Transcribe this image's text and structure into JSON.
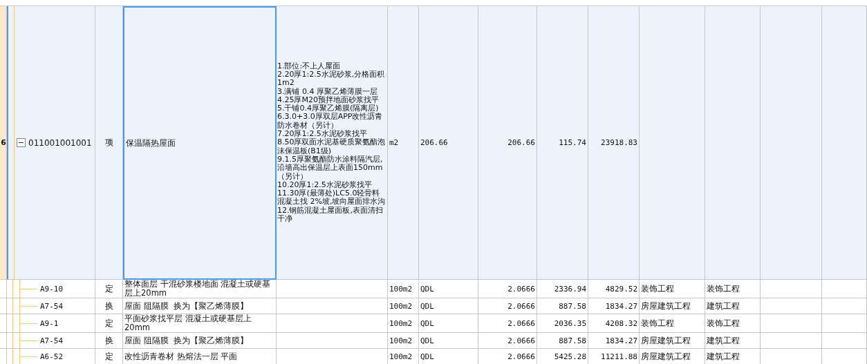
{
  "rows": [
    {
      "number": "6",
      "code": "011001001001",
      "item_type": "项",
      "name": "保温隔热屋面",
      "description_lines": [
        "1.部位:不上人屋面",
        "2.20厚1:2.5水泥砂浆,分格面积 1m2",
        "3.满铺 0.4 厚聚乙烯薄膜一层",
        "4.25厚M20预拌地面砂浆找平",
        "5.干铺0.4厚聚乙烯膜(隔离层)",
        "6.3.0+3.0厚双层APP改性沥青防水卷材（另计）",
        "7.20厚1:2.5水泥砂浆找平",
        "8.50厚双面水泥基硬质聚氨酯泡沫保温板(B1级)",
        "9.1.5厚聚氨酯防水涂料隔汽层,沿墙高出保温层上表面150mm（另计）",
        "10.20厚1:2.5水泥砂浆找平",
        "11.30厚(最薄处)LC5.0轻骨料混凝土找 2%坡,坡向屋面排水沟",
        "12.钢筋混凝土屋面板,表面清扫干净"
      ],
      "unit": "m2",
      "expression": "206.66",
      "quantity": "206.66",
      "unit_price": "115.74",
      "total": "23918.83",
      "expanded": true,
      "selected": true,
      "children": [
        {
          "code": "A9-10",
          "item_type": "定",
          "name": "整体面层 干混砂浆楼地面 混凝土或硬基层上20mm",
          "unit": "100m2",
          "expression": "QDL",
          "quantity": "2.0666",
          "unit_price": "2336.94",
          "total": "4829.52",
          "category": "装饰工程",
          "discipline": "装饰工程",
          "selected": false
        },
        {
          "code": "A7-54",
          "item_type": "换",
          "name": "屋面 阻隔膜  换为【聚乙烯薄膜】",
          "unit": "100m2",
          "expression": "QDL",
          "quantity": "2.0666",
          "unit_price": "887.58",
          "total": "1834.27",
          "category": "房屋建筑工程",
          "discipline": "建筑工程",
          "selected": false
        },
        {
          "code": "A9-1",
          "item_type": "定",
          "name": "平面砂浆找平层 混凝土或硬基层上20mm",
          "unit": "100m2",
          "expression": "QDL",
          "quantity": "2.0666",
          "unit_price": "2036.35",
          "total": "4208.32",
          "category": "装饰工程",
          "discipline": "装饰工程",
          "selected": false
        },
        {
          "code": "A7-54",
          "item_type": "换",
          "name": "屋面 阻隔膜  换为【聚乙烯薄膜】",
          "unit": "100m2",
          "expression": "QDL",
          "quantity": "2.0666",
          "unit_price": "887.58",
          "total": "1834.27",
          "category": "房屋建筑工程",
          "discipline": "建筑工程",
          "selected": false
        },
        {
          "code": "A6-52",
          "item_type": "定",
          "name": "改性沥青卷材 热熔法一层 平面",
          "unit": "100m2",
          "expression": "QDL",
          "quantity": "2.0666",
          "unit_price": "5425.28",
          "total": "11211.88",
          "category": "房屋建筑工程",
          "discipline": "建筑工程",
          "selected": false
        }
      ]
    }
  ]
}
